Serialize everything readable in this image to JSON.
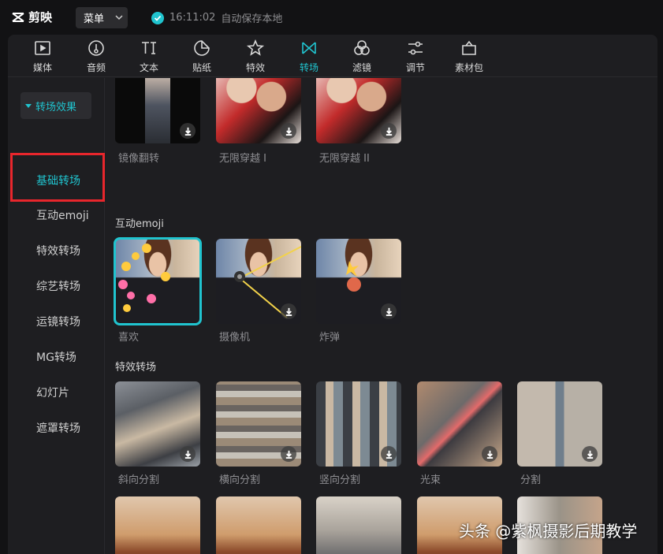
{
  "app": {
    "title": "剪映",
    "menu_label": "菜单",
    "save_time": "16:11:02",
    "save_text": "自动保存本地"
  },
  "accent_color": "#20c4cf",
  "toolbar": {
    "tools": [
      {
        "label": "媒体",
        "icon": "media-icon"
      },
      {
        "label": "音频",
        "icon": "audio-icon"
      },
      {
        "label": "文本",
        "icon": "text-icon"
      },
      {
        "label": "贴纸",
        "icon": "sticker-icon"
      },
      {
        "label": "特效",
        "icon": "effects-icon"
      },
      {
        "label": "转场",
        "icon": "transition-icon",
        "active": true
      },
      {
        "label": "滤镜",
        "icon": "filter-icon"
      },
      {
        "label": "调节",
        "icon": "adjust-icon"
      },
      {
        "label": "素材包",
        "icon": "package-icon"
      }
    ]
  },
  "sidebar": {
    "header": "转场效果",
    "items": [
      "基础转场",
      "互动emoji",
      "特效转场",
      "综艺转场",
      "运镜转场",
      "MG转场",
      "幻灯片",
      "遮罩转场"
    ]
  },
  "content": {
    "row0": [
      "镜像翻转",
      "无限穿越 I",
      "无限穿越 II"
    ],
    "section_emoji": "互动emoji",
    "row1": [
      "喜欢",
      "摄像机",
      "炸弹"
    ],
    "section_effects": "特效转场",
    "row2": [
      "斜向分割",
      "横向分割",
      "竖向分割",
      "光束",
      "分割"
    ]
  },
  "watermark": "头条 @紫枫摄影后期教学"
}
